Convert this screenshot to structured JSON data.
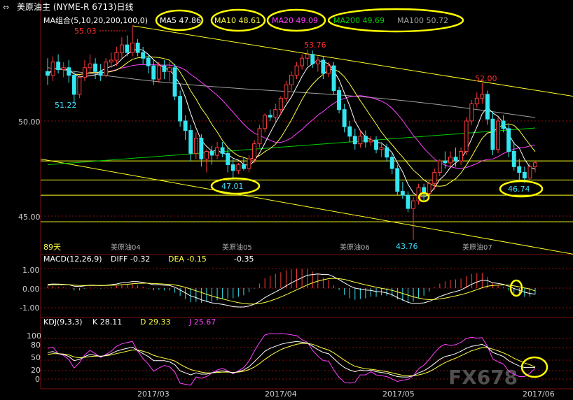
{
  "header": {
    "title": "美原油主 (NYME-R 6713)日线",
    "ma_group": "MA组合(5,10,20,200,100,0)",
    "ma5": "MA5 47.86",
    "ma10": "MA10 48.61",
    "ma20": "MA20 49.09",
    "ma200": "MA200 49.69",
    "ma100": "MA100 50.72"
  },
  "price_panel": {
    "y_labels": [
      "50.00",
      "45.00"
    ],
    "period_label": "89天",
    "contract_labels": [
      "美原油04",
      "美原油05",
      "美原油06",
      "美原油07"
    ],
    "annotations": [
      {
        "text": "55.03",
        "color": "#ff3030"
      },
      {
        "text": "51.22",
        "color": "#40e0ff"
      },
      {
        "text": "53.76",
        "color": "#ff3030"
      },
      {
        "text": "47.01",
        "color": "#40e0ff"
      },
      {
        "text": "52.00",
        "color": "#ff3030"
      },
      {
        "text": "43.76",
        "color": "#40e0ff"
      },
      {
        "text": "46.74",
        "color": "#40e0ff"
      }
    ]
  },
  "macd_panel": {
    "name": "MACD(12,26,9)",
    "diff": "DIFF  -0.32",
    "dea": "DEA  -0.15",
    "macd": "-0.35",
    "y_labels": [
      "1.00",
      "0.00",
      "-1.00"
    ]
  },
  "kdj_panel": {
    "name": "KDJ(9,3,3)",
    "k": "K  28.11",
    "d": "D  29.33",
    "j": "J  25.67",
    "y_labels": [
      "100",
      "80",
      "50",
      "20",
      "0"
    ]
  },
  "x_axis": [
    "2017/03",
    "2017/04",
    "2017/05",
    "2017/06"
  ],
  "watermark": {
    "text": "FX678"
  },
  "colors": {
    "up": "#ff3c3c",
    "down": "#33e6f0",
    "ma5": "#ffffff",
    "ma10": "#ffff40",
    "ma20": "#ff40ff",
    "ma200": "#00d000",
    "ma100": "#a0a0a0",
    "trendline": "#ffff20",
    "grid": "#8b1010"
  },
  "chart_data": [
    {
      "type": "candlestick",
      "title": "美原油主 (NYME-R 6713)日线",
      "ylim": [
        43.5,
        56.0
      ],
      "candles": [
        [
          52.6,
          53.3,
          51.9,
          52.4
        ],
        [
          52.4,
          53.4,
          52.1,
          53.1
        ],
        [
          53.1,
          53.5,
          52.5,
          52.7
        ],
        [
          52.7,
          53.1,
          52.3,
          52.8
        ],
        [
          52.8,
          53.2,
          52.0,
          52.4
        ],
        [
          52.4,
          52.6,
          50.9,
          51.4
        ],
        [
          51.4,
          52.4,
          51.2,
          52.3
        ],
        [
          52.3,
          53.2,
          52.1,
          52.8
        ],
        [
          52.8,
          53.5,
          52.5,
          53.0
        ],
        [
          53.0,
          53.3,
          52.2,
          52.6
        ],
        [
          52.6,
          53.0,
          52.1,
          52.4
        ],
        [
          52.4,
          53.3,
          52.3,
          53.1
        ],
        [
          53.1,
          53.6,
          52.8,
          53.2
        ],
        [
          53.2,
          53.9,
          52.9,
          53.6
        ],
        [
          53.6,
          54.4,
          53.3,
          54.0
        ],
        [
          54.0,
          54.5,
          53.4,
          53.6
        ],
        [
          53.6,
          55.03,
          53.4,
          54.1
        ],
        [
          54.1,
          54.3,
          53.4,
          53.6
        ],
        [
          53.6,
          53.9,
          53.0,
          53.3
        ],
        [
          53.3,
          53.5,
          52.5,
          52.9
        ],
        [
          52.9,
          53.2,
          51.9,
          52.2
        ],
        [
          52.2,
          53.1,
          52.0,
          52.9
        ],
        [
          52.9,
          53.2,
          52.2,
          52.6
        ],
        [
          52.6,
          53.1,
          52.1,
          52.8
        ],
        [
          52.8,
          53.0,
          51.1,
          51.3
        ],
        [
          51.3,
          51.6,
          49.7,
          50.0
        ],
        [
          50.0,
          50.3,
          49.0,
          49.5
        ],
        [
          49.5,
          49.8,
          47.9,
          48.3
        ],
        [
          48.3,
          49.4,
          48.0,
          49.1
        ],
        [
          49.1,
          49.3,
          47.6,
          48.0
        ],
        [
          48.0,
          48.5,
          47.3,
          48.4
        ],
        [
          48.4,
          48.7,
          47.7,
          48.2
        ],
        [
          48.2,
          48.9,
          48.0,
          48.6
        ],
        [
          48.6,
          48.9,
          48.1,
          48.3
        ],
        [
          48.3,
          48.6,
          47.3,
          47.7
        ],
        [
          47.7,
          48.0,
          47.01,
          47.4
        ],
        [
          47.4,
          47.8,
          47.2,
          47.7
        ],
        [
          47.7,
          48.1,
          47.4,
          47.5
        ],
        [
          47.5,
          48.2,
          47.3,
          48.0
        ],
        [
          48.0,
          49.0,
          47.8,
          48.8
        ],
        [
          48.8,
          49.8,
          48.6,
          49.6
        ],
        [
          49.6,
          50.4,
          49.4,
          50.3
        ],
        [
          50.3,
          50.6,
          50.0,
          50.2
        ],
        [
          50.2,
          50.9,
          49.9,
          50.6
        ],
        [
          50.6,
          51.3,
          50.3,
          51.2
        ],
        [
          51.2,
          52.1,
          51.0,
          51.9
        ],
        [
          51.9,
          52.6,
          51.6,
          52.4
        ],
        [
          52.4,
          53.1,
          52.2,
          52.9
        ],
        [
          52.9,
          53.5,
          52.7,
          53.3
        ],
        [
          53.3,
          53.76,
          52.9,
          53.5
        ],
        [
          53.5,
          53.7,
          52.8,
          53.0
        ],
        [
          53.0,
          53.4,
          52.6,
          53.2
        ],
        [
          53.2,
          53.4,
          52.2,
          52.5
        ],
        [
          52.5,
          53.1,
          52.3,
          52.9
        ],
        [
          52.9,
          53.1,
          51.4,
          51.6
        ],
        [
          51.6,
          51.8,
          50.4,
          50.6
        ],
        [
          50.6,
          50.9,
          49.4,
          49.7
        ],
        [
          49.7,
          50.0,
          48.9,
          49.2
        ],
        [
          49.2,
          49.6,
          48.5,
          48.8
        ],
        [
          48.8,
          49.5,
          48.6,
          49.2
        ],
        [
          49.2,
          49.5,
          48.6,
          48.9
        ],
        [
          48.9,
          49.2,
          48.7,
          49.0
        ],
        [
          49.0,
          49.2,
          48.3,
          48.5
        ],
        [
          48.5,
          48.9,
          48.1,
          48.6
        ],
        [
          48.6,
          48.8,
          47.9,
          48.1
        ],
        [
          48.1,
          48.3,
          47.2,
          47.5
        ],
        [
          47.5,
          47.7,
          46.1,
          46.3
        ],
        [
          46.3,
          46.8,
          45.9,
          46.1
        ],
        [
          46.1,
          46.3,
          45.2,
          45.4
        ],
        [
          45.4,
          46.0,
          43.76,
          45.8
        ],
        [
          45.8,
          46.7,
          45.6,
          46.5
        ],
        [
          46.5,
          46.7,
          45.8,
          46.2
        ],
        [
          46.2,
          46.9,
          45.9,
          46.7
        ],
        [
          46.7,
          47.5,
          46.4,
          47.3
        ],
        [
          47.3,
          48.0,
          47.1,
          47.9
        ],
        [
          47.9,
          48.4,
          47.5,
          47.8
        ],
        [
          47.8,
          48.4,
          47.6,
          48.1
        ],
        [
          48.1,
          48.6,
          47.6,
          47.9
        ],
        [
          47.9,
          48.6,
          47.7,
          48.4
        ],
        [
          48.4,
          50.2,
          48.2,
          50.0
        ],
        [
          50.0,
          51.1,
          49.8,
          50.9
        ],
        [
          50.9,
          51.5,
          50.7,
          51.2
        ],
        [
          51.2,
          52.0,
          50.9,
          51.4
        ],
        [
          51.4,
          51.6,
          49.8,
          50.1
        ],
        [
          50.1,
          50.5,
          48.2,
          48.5
        ],
        [
          48.5,
          50.2,
          48.3,
          50.0
        ],
        [
          50.0,
          50.3,
          49.4,
          49.6
        ],
        [
          49.6,
          49.8,
          48.1,
          48.4
        ],
        [
          48.4,
          48.9,
          47.4,
          47.6
        ],
        [
          47.6,
          48.0,
          46.9,
          47.3
        ],
        [
          47.3,
          47.6,
          46.74,
          47.0
        ],
        [
          47.0,
          47.8,
          46.9,
          47.6
        ],
        [
          47.6,
          47.9,
          47.3,
          47.8
        ]
      ]
    },
    {
      "type": "bar",
      "title": "MACD(12,26,9)",
      "ylim": [
        -1.2,
        1.2
      ],
      "series": [
        {
          "name": "DIFF",
          "values": [
            0.2,
            0.22,
            0.21,
            0.2,
            0.18,
            0.1,
            0.08,
            0.12,
            0.16,
            0.15,
            0.13,
            0.15,
            0.18,
            0.22,
            0.28,
            0.3,
            0.35,
            0.34,
            0.3,
            0.25,
            0.18,
            0.18,
            0.15,
            0.14,
            0.05,
            -0.1,
            -0.25,
            -0.42,
            -0.5,
            -0.62,
            -0.7,
            -0.78,
            -0.82,
            -0.86,
            -0.92,
            -0.98,
            -1.0,
            -1.0,
            -0.95,
            -0.85,
            -0.7,
            -0.5,
            -0.35,
            -0.2,
            -0.05,
            0.12,
            0.28,
            0.42,
            0.55,
            0.68,
            0.72,
            0.75,
            0.72,
            0.72,
            0.6,
            0.45,
            0.28,
            0.12,
            0.0,
            -0.05,
            -0.1,
            -0.12,
            -0.18,
            -0.2,
            -0.26,
            -0.35,
            -0.5,
            -0.62,
            -0.75,
            -0.82,
            -0.8,
            -0.78,
            -0.7,
            -0.58,
            -0.45,
            -0.35,
            -0.25,
            -0.18,
            -0.1,
            0.05,
            0.2,
            0.32,
            0.42,
            0.4,
            0.28,
            0.25,
            0.2,
            0.1,
            -0.02,
            -0.12,
            -0.22,
            -0.28,
            -0.32
          ]
        },
        {
          "name": "DEA",
          "values": [
            0.15,
            0.17,
            0.18,
            0.18,
            0.18,
            0.16,
            0.14,
            0.14,
            0.14,
            0.14,
            0.14,
            0.14,
            0.15,
            0.16,
            0.18,
            0.2,
            0.23,
            0.25,
            0.26,
            0.26,
            0.24,
            0.23,
            0.21,
            0.2,
            0.17,
            0.11,
            0.04,
            -0.05,
            -0.14,
            -0.23,
            -0.33,
            -0.42,
            -0.5,
            -0.57,
            -0.64,
            -0.71,
            -0.77,
            -0.81,
            -0.84,
            -0.84,
            -0.82,
            -0.76,
            -0.68,
            -0.58,
            -0.47,
            -0.35,
            -0.22,
            -0.09,
            0.04,
            0.17,
            0.28,
            0.37,
            0.44,
            0.5,
            0.52,
            0.5,
            0.46,
            0.39,
            0.31,
            0.24,
            0.17,
            0.11,
            0.05,
            -0.01,
            -0.06,
            -0.12,
            -0.2,
            -0.28,
            -0.37,
            -0.46,
            -0.53,
            -0.58,
            -0.61,
            -0.6,
            -0.57,
            -0.53,
            -0.47,
            -0.41,
            -0.35,
            -0.27,
            -0.18,
            -0.08,
            0.02,
            0.1,
            0.14,
            0.16,
            0.17,
            0.16,
            0.12,
            0.07,
            0.01,
            -0.05,
            -0.15
          ]
        }
      ]
    },
    {
      "type": "line",
      "title": "KDJ(9,3,3)",
      "ylim": [
        0,
        100
      ],
      "series": [
        {
          "name": "K",
          "values": [
            65,
            67,
            62,
            60,
            55,
            45,
            48,
            55,
            60,
            58,
            55,
            58,
            62,
            68,
            72,
            75,
            78,
            70,
            62,
            55,
            45,
            45,
            45,
            42,
            35,
            20,
            15,
            10,
            15,
            12,
            12,
            15,
            18,
            20,
            18,
            15,
            18,
            22,
            30,
            42,
            55,
            68,
            75,
            80,
            85,
            88,
            90,
            92,
            90,
            88,
            80,
            72,
            65,
            62,
            50,
            38,
            28,
            22,
            18,
            22,
            20,
            22,
            18,
            16,
            14,
            10,
            6,
            5,
            5,
            8,
            15,
            20,
            28,
            38,
            48,
            55,
            58,
            62,
            68,
            75,
            80,
            82,
            85,
            78,
            65,
            60,
            55,
            45,
            38,
            32,
            28,
            28,
            28
          ]
        },
        {
          "name": "D",
          "values": [
            60,
            62,
            62,
            61,
            59,
            54,
            52,
            53,
            55,
            56,
            56,
            57,
            59,
            62,
            65,
            68,
            71,
            71,
            68,
            64,
            58,
            54,
            51,
            48,
            44,
            36,
            29,
            23,
            20,
            17,
            15,
            15,
            16,
            17,
            17,
            16,
            17,
            19,
            23,
            29,
            38,
            48,
            57,
            65,
            72,
            77,
            81,
            85,
            87,
            87,
            85,
            80,
            75,
            71,
            64,
            55,
            46,
            38,
            31,
            28,
            25,
            24,
            22,
            20,
            18,
            15,
            12,
            9,
            8,
            8,
            10,
            13,
            18,
            25,
            33,
            40,
            46,
            51,
            57,
            63,
            69,
            73,
            77,
            77,
            73,
            69,
            64,
            58,
            51,
            45,
            39,
            35,
            29
          ]
        },
        {
          "name": "J",
          "values": [
            75,
            78,
            62,
            58,
            47,
            27,
            40,
            59,
            70,
            62,
            53,
            60,
            68,
            80,
            86,
            89,
            92,
            68,
            50,
            37,
            19,
            27,
            33,
            30,
            17,
            -10,
            -13,
            -16,
            5,
            2,
            6,
            15,
            22,
            26,
            20,
            13,
            20,
            28,
            44,
            68,
            89,
            108,
            111,
            110,
            111,
            110,
            108,
            106,
            96,
            90,
            70,
            56,
            45,
            44,
            22,
            4,
            -8,
            -10,
            -8,
            10,
            10,
            18,
            10,
            8,
            6,
            0,
            -6,
            -3,
            -1,
            8,
            25,
            34,
            48,
            64,
            78,
            85,
            82,
            84,
            90,
            99,
            102,
            100,
            101,
            80,
            49,
            42,
            37,
            19,
            12,
            6,
            6,
            14,
            26
          ]
        }
      ]
    }
  ]
}
